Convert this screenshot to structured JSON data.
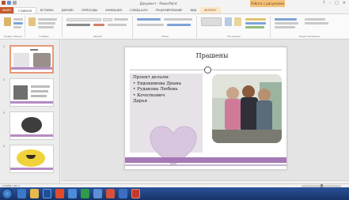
{
  "title_bar": {
    "document_title": "Документ - PowerPoint",
    "context_tab": "Работа с рисунками"
  },
  "ribbon": {
    "tabs": [
      "ФАЙЛ",
      "ГЛАВНАЯ",
      "ВСТАВКА",
      "ДИЗАЙН",
      "ПЕРЕХОДЫ",
      "АНИМАЦИЯ",
      "СЛАЙД-ШОУ",
      "РЕЦЕНЗИРОВАНИЕ",
      "ВИД",
      "ФОРМАТ"
    ],
    "active_tab": "ГЛАВНАЯ",
    "groups": [
      "Буфер обмена",
      "Слайды",
      "Шрифт",
      "Абзац",
      "Рисование",
      "Редактирование"
    ]
  },
  "thumbnails": {
    "numbers": [
      "1",
      "2",
      "3",
      "4"
    ],
    "selected": "1"
  },
  "slide": {
    "title": "Прашены",
    "text_lines": [
      "Проект делали:",
      "• Евдокимова Диана",
      "• Рудакова  Любовь",
      "• Кочеткович",
      "  Дарья"
    ]
  },
  "status_bar": {
    "left": "СЛАЙД 1 ИЗ 4",
    "zoom": ""
  },
  "taskbar": {
    "clock_time": "",
    "clock_date": ""
  },
  "colors": {
    "accent": "#a579b5",
    "file_tab": "#c55a2d",
    "taskbar": "#1d3d7a"
  }
}
